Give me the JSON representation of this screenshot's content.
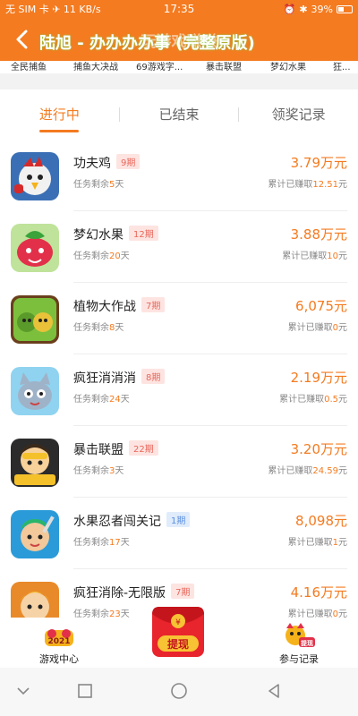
{
  "status": {
    "left": "无 SIM 卡 ✈ 11 KB/s",
    "time": "17:35",
    "battery": "39%"
  },
  "header": {
    "title_under": "玩游戏赚赚",
    "title": "陆旭 - 办办办办事 (完整原版)"
  },
  "strip": [
    "全民捕鱼",
    "捕鱼大决战",
    "69游戏字...",
    "暴击联盟",
    "梦幻水果",
    "狂..."
  ],
  "tabs": [
    {
      "label": "进行中"
    },
    {
      "label": "已结束"
    },
    {
      "label": "领奖记录"
    }
  ],
  "rows": [
    {
      "name": "功夫鸡",
      "issue": "9期",
      "issue_color": "red",
      "remain_prefix": "任务剩余",
      "remain_days": "5",
      "remain_suffix": "天",
      "amount": "3.79万元",
      "earned_prefix": "累计已赚取",
      "earned": "12.51",
      "earned_suffix": "元"
    },
    {
      "name": "梦幻水果",
      "issue": "12期",
      "issue_color": "red",
      "remain_prefix": "任务剩余",
      "remain_days": "20",
      "remain_suffix": "天",
      "amount": "3.88万元",
      "earned_prefix": "累计已赚取",
      "earned": "10",
      "earned_suffix": "元"
    },
    {
      "name": "植物大作战",
      "issue": "7期",
      "issue_color": "red",
      "remain_prefix": "任务剩余",
      "remain_days": "8",
      "remain_suffix": "天",
      "amount": "6,075元",
      "earned_prefix": "累计已赚取",
      "earned": "0",
      "earned_suffix": "元"
    },
    {
      "name": "疯狂消消消",
      "issue": "8期",
      "issue_color": "red",
      "remain_prefix": "任务剩余",
      "remain_days": "24",
      "remain_suffix": "天",
      "amount": "2.19万元",
      "earned_prefix": "累计已赚取",
      "earned": "0.5",
      "earned_suffix": "元"
    },
    {
      "name": "暴击联盟",
      "issue": "22期",
      "issue_color": "red",
      "remain_prefix": "任务剩余",
      "remain_days": "3",
      "remain_suffix": "天",
      "amount": "3.20万元",
      "earned_prefix": "累计已赚取",
      "earned": "24.59",
      "earned_suffix": "元"
    },
    {
      "name": "水果忍者闯关记",
      "issue": "1期",
      "issue_color": "blue",
      "remain_prefix": "任务剩余",
      "remain_days": "17",
      "remain_suffix": "天",
      "amount": "8,098元",
      "earned_prefix": "累计已赚取",
      "earned": "1",
      "earned_suffix": "元"
    },
    {
      "name": "疯狂消除-无限版",
      "issue": "7期",
      "issue_color": "red",
      "remain_prefix": "任务剩余",
      "remain_days": "23",
      "remain_suffix": "天",
      "amount": "4.16万元",
      "earned_prefix": "累计已赚取",
      "earned": "0",
      "earned_suffix": "元"
    }
  ],
  "bottom_nav": {
    "left_label": "游戏中心",
    "withdraw_label": "提现",
    "right_label": "参与记录",
    "right_badge": "提现",
    "left_badge": "2021"
  },
  "colors": {
    "accent": "#f47b20",
    "issue_red": "#e8675b",
    "issue_blue": "#5a8ee0"
  }
}
